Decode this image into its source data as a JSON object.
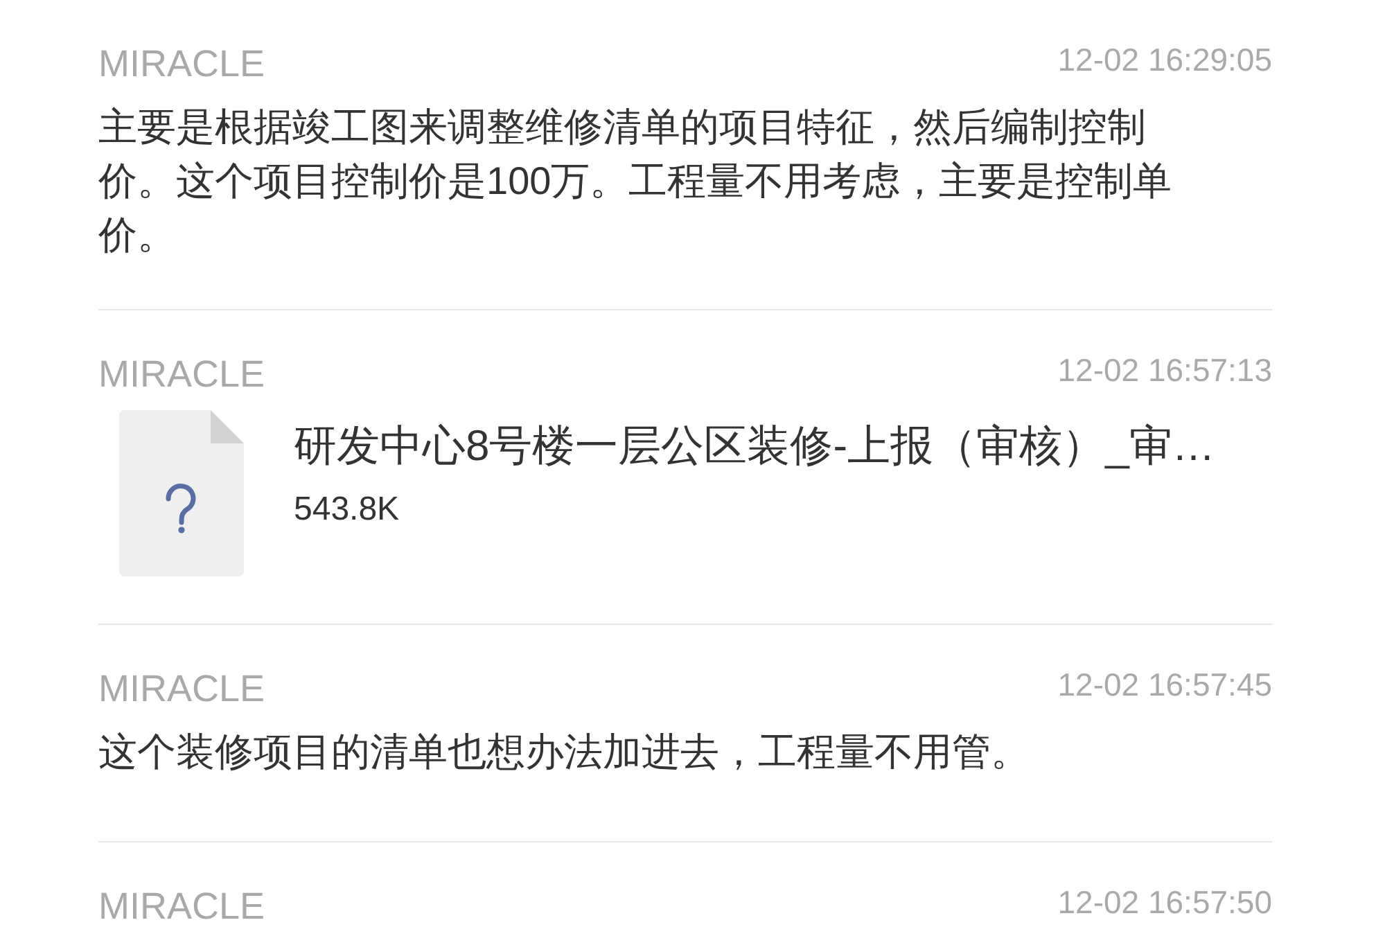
{
  "messages": [
    {
      "kind": "text",
      "sender": "MIRACLE",
      "time": "12-02 16:29:05",
      "text": "主要是根据竣工图来调整维修清单的项目特征，然后编制控制价。这个项目控制价是100万。工程量不用考虑，主要是控制单价。"
    },
    {
      "kind": "file",
      "sender": "MIRACLE",
      "time": "12-02 16:57:13",
      "file_name": "研发中心8号楼一层公区装修-上报（审核）_审…",
      "file_size": "543.8K"
    },
    {
      "kind": "text",
      "sender": "MIRACLE",
      "time": "12-02 16:57:45",
      "text": "这个装修项目的清单也想办法加进去，工程量不用管。"
    },
    {
      "sender": "MIRACLE",
      "time": "12-02 16:57:50"
    }
  ]
}
